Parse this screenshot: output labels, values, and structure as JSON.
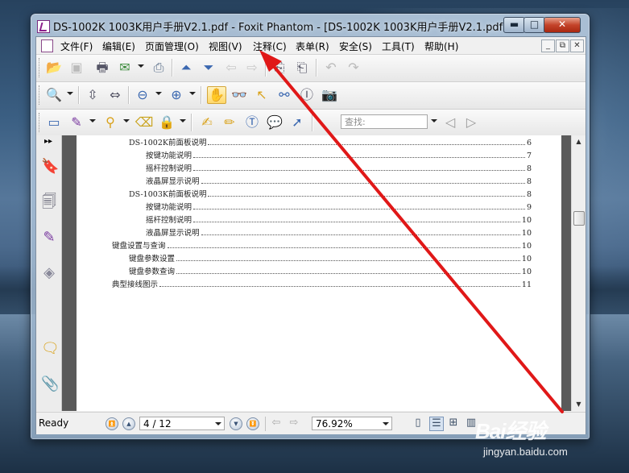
{
  "window": {
    "title": "DS-1002K 1003K用户手册V2.1.pdf - Foxit Phantom - [DS-1002K 1003K用户手册V2.1.pdf]",
    "minimize": "▬",
    "maximize": "□",
    "close": "✕"
  },
  "menu": [
    {
      "label": "文件(F)"
    },
    {
      "label": "编辑(E)"
    },
    {
      "label": "页面管理(O)"
    },
    {
      "label": "视图(V)"
    },
    {
      "label": "注释(C)"
    },
    {
      "label": "表单(R)"
    },
    {
      "label": "安全(S)"
    },
    {
      "label": "工具(T)"
    },
    {
      "label": "帮助(H)"
    }
  ],
  "mdi": {
    "minimize": "_",
    "restore": "⧉",
    "close": "✕"
  },
  "search": {
    "placeholder": "查找:"
  },
  "sidebar": {
    "expand": "▸▸"
  },
  "toc": [
    {
      "title": "DS-1002K前面板说明",
      "page": "6"
    },
    {
      "title": "按键功能说明",
      "page": "7"
    },
    {
      "title": "摇杆控制说明",
      "page": "8"
    },
    {
      "title": "液晶屏显示说明",
      "page": "8"
    },
    {
      "title": "DS-1003K前面板说明",
      "page": "8"
    },
    {
      "title": "按键功能说明",
      "page": "9"
    },
    {
      "title": "摇杆控制说明",
      "page": "10"
    },
    {
      "title": "液晶屏显示说明",
      "page": "10"
    },
    {
      "title": "键盘设置与查询",
      "page": "10"
    },
    {
      "title": "键盘参数设置",
      "page": "10"
    },
    {
      "title": "键盘参数查询",
      "page": "10"
    },
    {
      "title": "典型接线图示",
      "page": "11"
    }
  ],
  "status": {
    "state": "Ready",
    "page_indicator": "4 / 12",
    "zoom": "76.92%"
  },
  "watermark": {
    "logo": "Bai经验",
    "site": "jingyan.baidu.com"
  },
  "colors": {
    "annotation_arrow": "#e01818",
    "title_bar": "#b8cde2"
  }
}
